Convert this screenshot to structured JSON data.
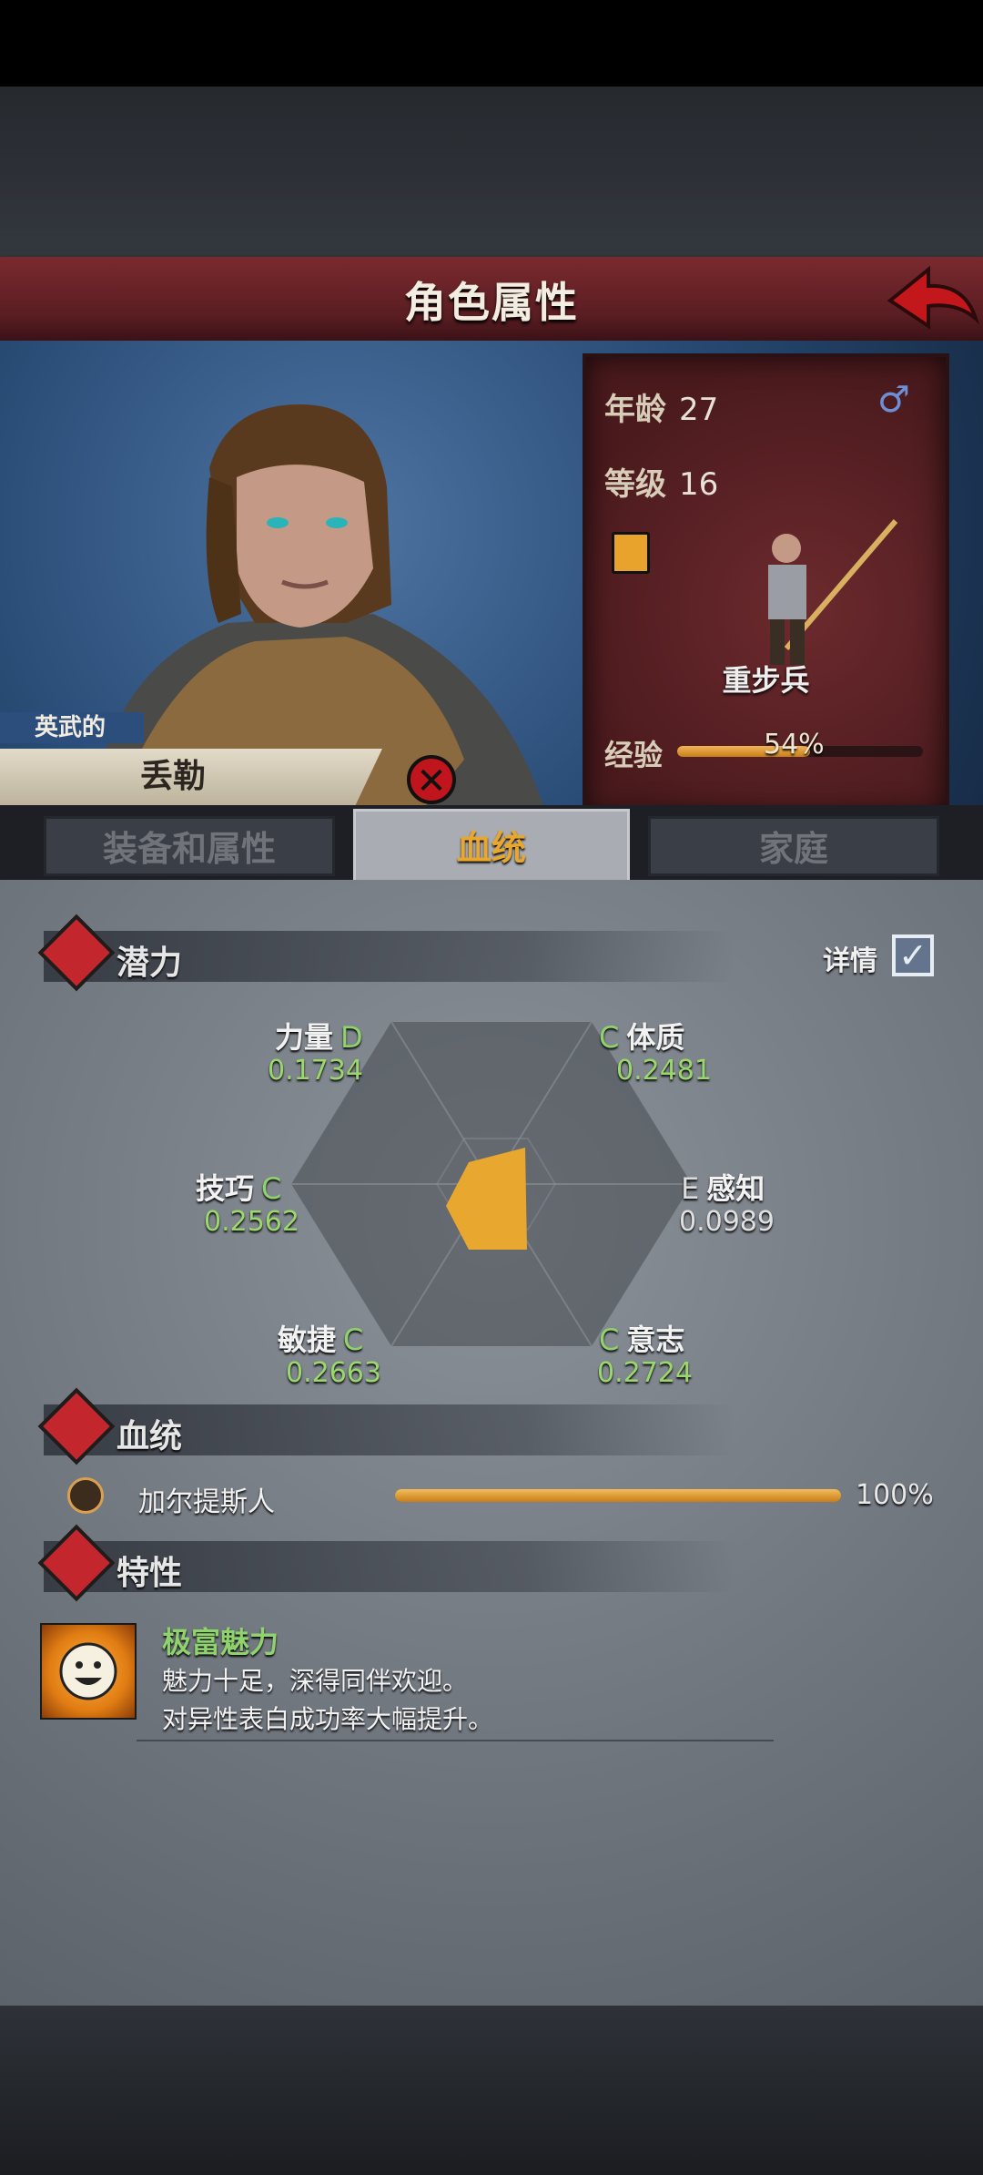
{
  "header": {
    "title": "角色属性"
  },
  "character": {
    "title_tag": "英武的",
    "name": "丢勒",
    "age_label": "年龄",
    "age": "27",
    "level_label": "等级",
    "level": "16",
    "class_name": "重步兵",
    "exp_label": "经验",
    "exp_percent_text": "54%",
    "exp_fraction": 0.54
  },
  "tabs": [
    {
      "label": "装备和属性",
      "active": false
    },
    {
      "label": "血统",
      "active": true
    },
    {
      "label": "家庭",
      "active": false
    }
  ],
  "potential": {
    "section_label": "潜力",
    "details_label": "详情",
    "details_checked": true,
    "stats": [
      {
        "name": "力量",
        "grade": "D",
        "value": "0.1734"
      },
      {
        "name": "体质",
        "grade": "C",
        "value": "0.2481"
      },
      {
        "name": "技巧",
        "grade": "C",
        "value": "0.2562"
      },
      {
        "name": "感知",
        "grade": "E",
        "value": "0.0989"
      },
      {
        "name": "敏捷",
        "grade": "C",
        "value": "0.2663"
      },
      {
        "name": "意志",
        "grade": "C",
        "value": "0.2724"
      }
    ]
  },
  "bloodline": {
    "section_label": "血统",
    "entries": [
      {
        "name": "加尔提斯人",
        "percent_text": "100%",
        "fraction": 1.0
      }
    ]
  },
  "traits": {
    "section_label": "特性",
    "items": [
      {
        "name": "极富魅力",
        "desc_line1": "魅力十足，深得同伴欢迎。",
        "desc_line2": "对异性表白成功率大幅提升。"
      }
    ]
  },
  "colors": {
    "accent_orange": "#e8a830",
    "grade_green": "#8fd26e",
    "header_red": "#6a2226"
  }
}
